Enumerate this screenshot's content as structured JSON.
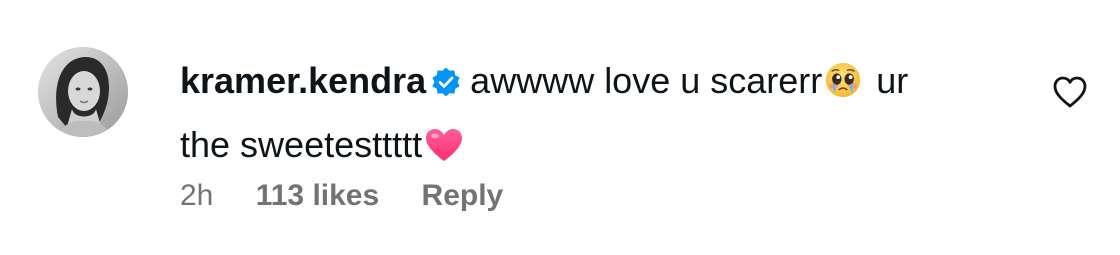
{
  "comment": {
    "username": "kramer.kendra",
    "text_line1": "awwww love u scarerr",
    "text_after_emoji": " ur",
    "text_line2": "the sweetesttttt",
    "time": "2h",
    "likes": "113 likes",
    "reply_label": "Reply",
    "icons": {
      "verified": "verified-badge-icon",
      "emoji1": "pleading-face-emoji",
      "emoji2": "pink-heart-emoji",
      "like": "heart-outline-icon"
    },
    "colors": {
      "verified": "#0095f6",
      "text": "#0f1419",
      "meta": "#737373",
      "heart": "#ff3b7f"
    }
  }
}
